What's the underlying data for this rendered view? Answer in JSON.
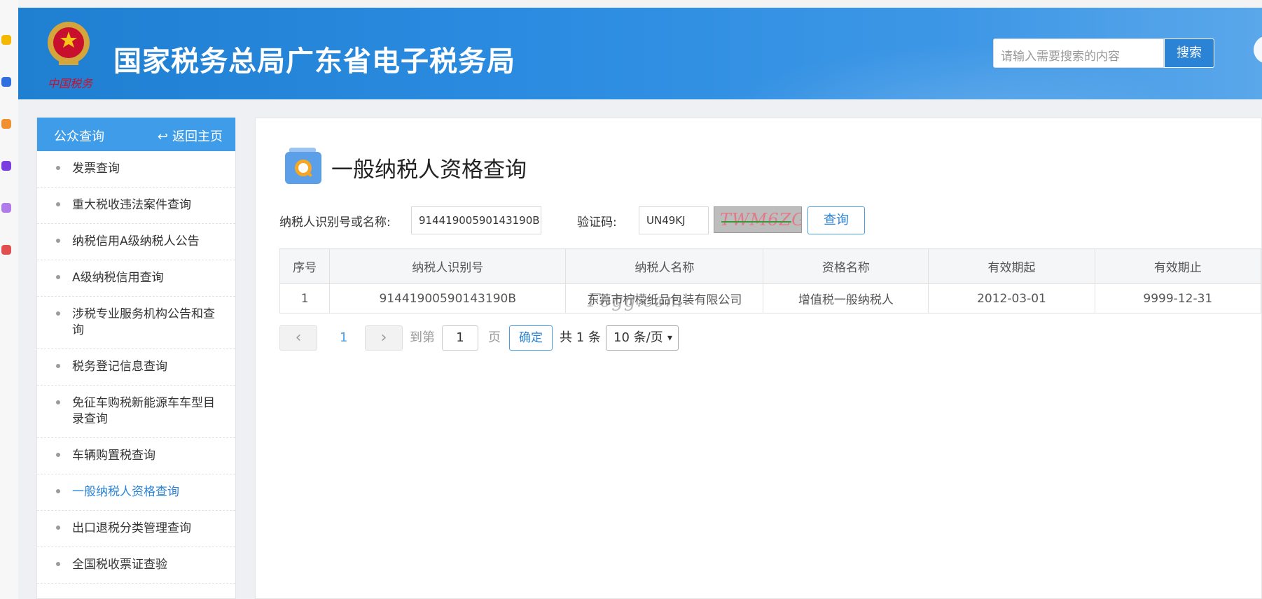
{
  "header": {
    "emblem_text": "中国税务",
    "site_title": "国家税务总局广东省电子税务局",
    "search_placeholder": "请输入需要搜索的内容",
    "search_button": "搜索"
  },
  "sidebar": {
    "title": "公众查询",
    "back_label": "返回主页",
    "items": [
      {
        "label": "发票查询"
      },
      {
        "label": "重大税收违法案件查询"
      },
      {
        "label": "纳税信用A级纳税人公告"
      },
      {
        "label": "A级纳税信用查询"
      },
      {
        "label": "涉税专业服务机构公告和查询"
      },
      {
        "label": "税务登记信息查询"
      },
      {
        "label": "免征车购税新能源车车型目录查询"
      },
      {
        "label": "车辆购置税查询"
      },
      {
        "label": "一般纳税人资格查询",
        "active": true
      },
      {
        "label": "出口退税分类管理查询"
      },
      {
        "label": "全国税收票证查验"
      }
    ]
  },
  "main": {
    "page_title": "一般纳税人资格查询",
    "query": {
      "taxpayer_label": "纳税人识别号或名称:",
      "taxpayer_value": "91441900590143190B",
      "captcha_label": "验证码:",
      "captcha_value": "UN49KJ",
      "captcha_image_text": "TWM6ZG",
      "query_button": "查询"
    },
    "table": {
      "headers": [
        "序号",
        "纳税人识别号",
        "纳税人名称",
        "资格名称",
        "有效期起",
        "有效期止"
      ],
      "rows": [
        [
          "1",
          "91441900590143190B",
          "东莞市柠檬纸品包装有限公司",
          "增值税一般纳税人",
          "2012-03-01",
          "9999-12-31"
        ]
      ],
      "watermark": "Fogg.com"
    },
    "pagination": {
      "prev": "‹",
      "current_page": "1",
      "next": "›",
      "goto_label": "到第",
      "goto_value": "1",
      "page_unit": "页",
      "confirm": "确定",
      "total": "共 1 条",
      "page_size": "10 条/页"
    }
  },
  "colors": {
    "header_blue": "#2a8be0",
    "sidebar_head": "#3e9ce8",
    "accent": "#2b83d6"
  }
}
